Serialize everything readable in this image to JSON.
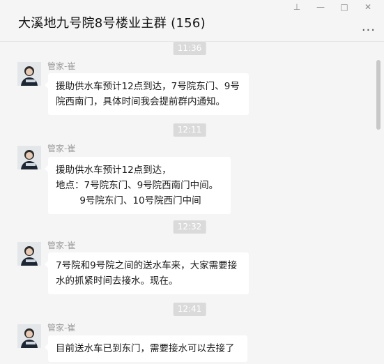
{
  "window": {
    "title": "大溪地九号院8号楼业主群 (156)",
    "controls": {
      "pin": "⊥",
      "minimize": "—",
      "maximize": "□",
      "close": "✕"
    },
    "more": "..."
  },
  "messages": [
    {
      "time": "11:36",
      "sender": "管家-崔",
      "text": "援助供水车预计12点到达，7号院东门、9号\n院西南门，具体时间我会提前群内通知。"
    },
    {
      "time": "12:11",
      "sender": "管家-崔",
      "text": "援助供水车预计12点到达，\n地点：7号院东门、9号院西南门中间。\n        9号院东门、10号院西门中间"
    },
    {
      "time": "12:32",
      "sender": "管家-崔",
      "text": "7号院和9号院之间的送水车来，大家需要接\n水的抓紧时间去接水。现在。"
    },
    {
      "time": "12:41",
      "sender": "管家-崔",
      "text": "目前送水车已到东门，需要接水可以去接了"
    }
  ],
  "colors": {
    "bubble": "#ffffff",
    "background": "#f5f5f5",
    "timestamp": "#dadada"
  }
}
